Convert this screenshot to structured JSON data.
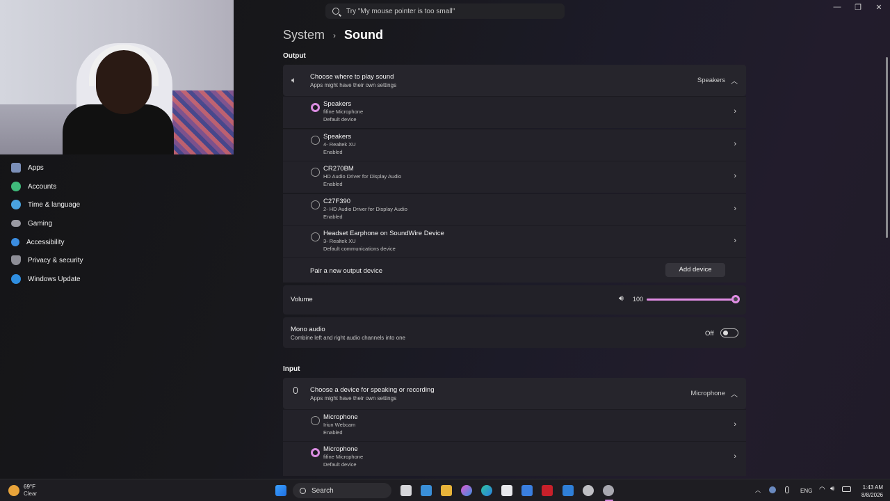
{
  "search": {
    "placeholder": "Try \"My mouse pointer is too small\""
  },
  "breadcrumb": {
    "parent": "System",
    "separator": "›",
    "current": "Sound"
  },
  "sidebar": {
    "items": [
      {
        "label": "Apps",
        "icon": "apps-icon",
        "color": "#7b8fb8"
      },
      {
        "label": "Accounts",
        "icon": "accounts-icon",
        "color": "#3fba7a"
      },
      {
        "label": "Time & language",
        "icon": "globe-clock-icon",
        "color": "#4aa3e0"
      },
      {
        "label": "Gaming",
        "icon": "gamepad-icon",
        "color": "#9a9aa3"
      },
      {
        "label": "Accessibility",
        "icon": "accessibility-icon",
        "color": "#3b8de0"
      },
      {
        "label": "Privacy & security",
        "icon": "shield-icon",
        "color": "#8d8d96"
      },
      {
        "label": "Windows Update",
        "icon": "update-icon",
        "color": "#2f8ee0"
      }
    ]
  },
  "output": {
    "heading": "Output",
    "chooser": {
      "title": "Choose where to play sound",
      "subtitle": "Apps might have their own settings",
      "value": "Speakers"
    },
    "devices": [
      {
        "name": "Speakers",
        "line1": "fifine Microphone",
        "line2": "Default device",
        "selected": true
      },
      {
        "name": "Speakers",
        "line1": "4- Realtek XU",
        "line2": "Enabled",
        "selected": false
      },
      {
        "name": "CR270BM",
        "line1": "HD Audio Driver for Display Audio",
        "line2": "Enabled",
        "selected": false
      },
      {
        "name": "C27F390",
        "line1": "2- HD Audio Driver for Display Audio",
        "line2": "Enabled",
        "selected": false
      },
      {
        "name": "Headset Earphone on SoundWire Device",
        "line1": "3- Realtek XU",
        "line2": "Default communications device",
        "selected": false
      }
    ],
    "pair": {
      "label": "Pair a new output device",
      "button": "Add device"
    },
    "volume": {
      "label": "Volume",
      "value": "100",
      "level": 1.0
    },
    "mono": {
      "title": "Mono audio",
      "subtitle": "Combine left and right audio channels into one",
      "state": "Off"
    }
  },
  "input": {
    "heading": "Input",
    "chooser": {
      "title": "Choose a device for speaking or recording",
      "subtitle": "Apps might have their own settings",
      "value": "Microphone"
    },
    "devices": [
      {
        "name": "Microphone",
        "line1": "Iriun Webcam",
        "line2": "Enabled",
        "selected": false
      },
      {
        "name": "Microphone",
        "line1": "fifine Microphone",
        "line2": "Default device",
        "selected": true
      }
    ]
  },
  "taskbar": {
    "weather": {
      "temp": "69°F",
      "condition": "Clear"
    },
    "search_label": "Search",
    "language": "ENG",
    "time": "1:43 AM",
    "date": "8/8/2026"
  },
  "colors": {
    "accent": "#e08de4"
  }
}
